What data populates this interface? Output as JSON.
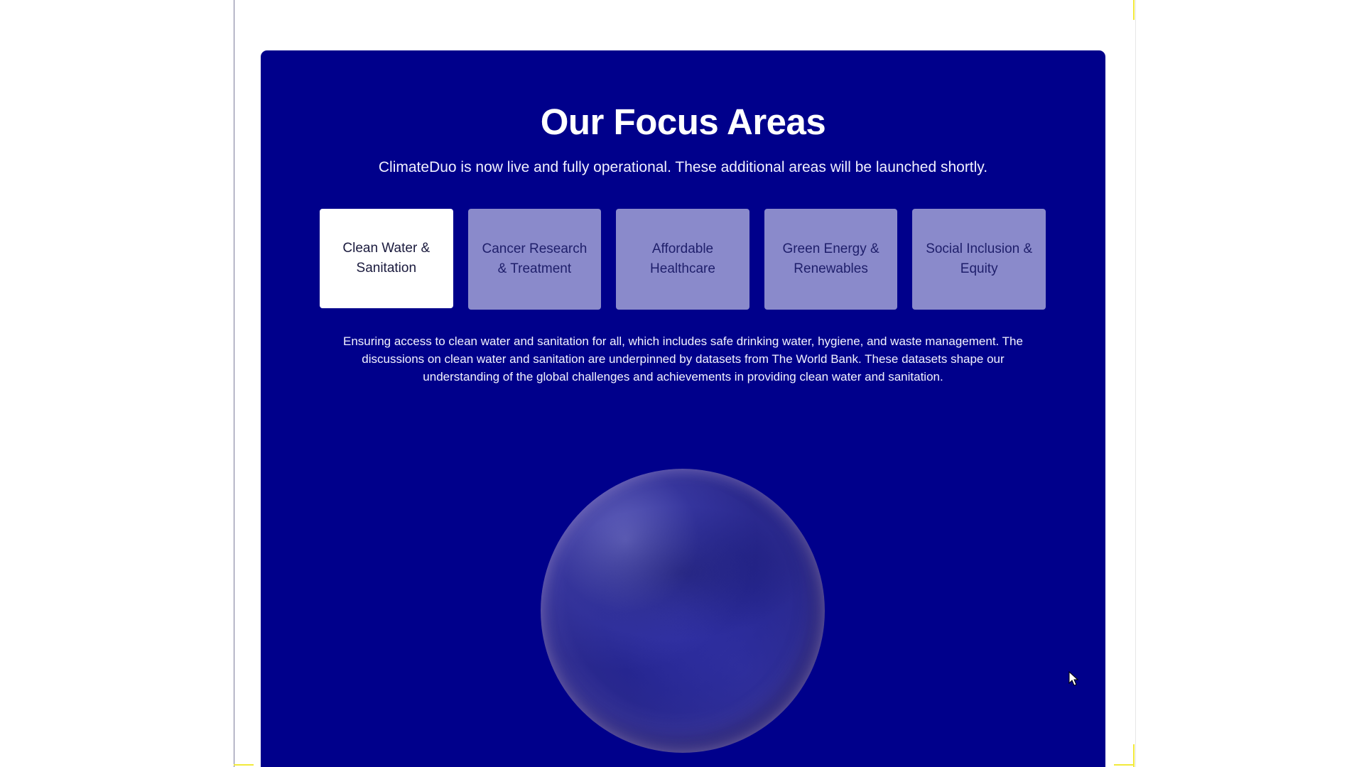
{
  "section": {
    "title": "Our Focus Areas",
    "subtitle": "ClimateDuo is now live and fully operational. These additional areas will be launched shortly."
  },
  "tabs": [
    {
      "label": "Clean Water & Sanitation",
      "active": true
    },
    {
      "label": "Cancer Research & Treatment",
      "active": false
    },
    {
      "label": "Affordable Healthcare",
      "active": false
    },
    {
      "label": "Green Energy & Renewables",
      "active": false
    },
    {
      "label": "Social Inclusion & Equity",
      "active": false
    }
  ],
  "description": "Ensuring access to clean water and sanitation for all, which includes safe drinking water, hygiene, and waste management. The discussions on clean water and sanitation are underpinned by datasets from The World Bank. These datasets shape our understanding of the global challenges and achievements in providing clean water and sanitation.",
  "visual": {
    "globe_icon": "globe-sphere",
    "cursor_icon": "mouse-pointer"
  },
  "colors": {
    "panel_background": "#00008b",
    "active_tab": "#ffffff",
    "inactive_tab": "#8a8acb",
    "text_light": "#ffffff"
  }
}
